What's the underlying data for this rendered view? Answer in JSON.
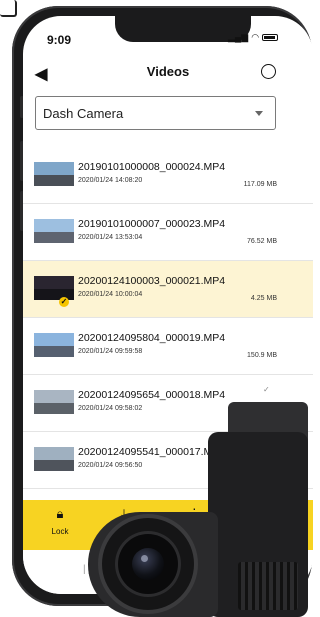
{
  "status_bar": {
    "time": "9:09"
  },
  "header": {
    "title": "Videos"
  },
  "camera_select": {
    "value": "Dash Camera"
  },
  "videos": [
    {
      "name": "20190101000008_000024.MP4",
      "date": "2020/01/24 14:08:20",
      "size": "117.09 MB",
      "selected": false
    },
    {
      "name": "20190101000007_000023.MP4",
      "date": "2020/01/24 13:53:04",
      "size": "76.52 MB",
      "selected": false
    },
    {
      "name": "20200124100003_000021.MP4",
      "date": "2020/01/24 10:00:04",
      "size": "4.25 MB",
      "selected": true
    },
    {
      "name": "20200124095804_000019.MP4",
      "date": "2020/01/24 09:59:58",
      "size": "150.9 MB",
      "selected": false
    },
    {
      "name": "20200124095654_000018.MP4",
      "date": "2020/01/24 09:58:02",
      "size": "",
      "selected": false
    },
    {
      "name": "20200124095541_000017.MP4",
      "date": "2020/01/24 09:56:50",
      "size": "",
      "selected": false
    }
  ],
  "toolbar": {
    "lock_label": "Lock"
  },
  "colors": {
    "accent": "#f7d322",
    "selected_row": "#fdf4d3"
  }
}
